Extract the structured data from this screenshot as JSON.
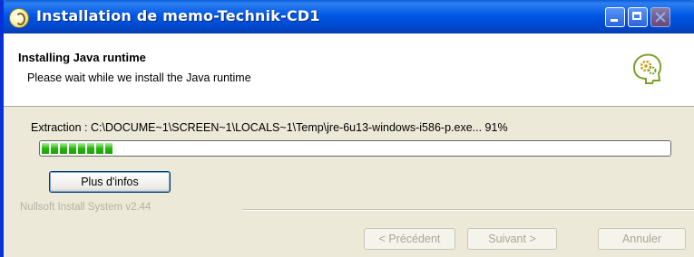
{
  "window": {
    "title": "Installation de memo-Technik-CD1"
  },
  "header": {
    "title": "Installing Java runtime",
    "subtitle": "Please wait while we install the Java runtime",
    "icon": "head-gears-icon"
  },
  "progress": {
    "status_text": "Extraction : C:\\DOCUME~1\\SCREEN~1\\LOCALS~1\\Temp\\jre-6u13-windows-i586-p.exe... 91%",
    "fraction": 0.12
  },
  "buttons": {
    "details": "Plus d'infos",
    "back": "< Précédent",
    "next": "Suivant >",
    "cancel": "Annuler"
  },
  "branding": "Nullsoft Install System v2.44"
}
